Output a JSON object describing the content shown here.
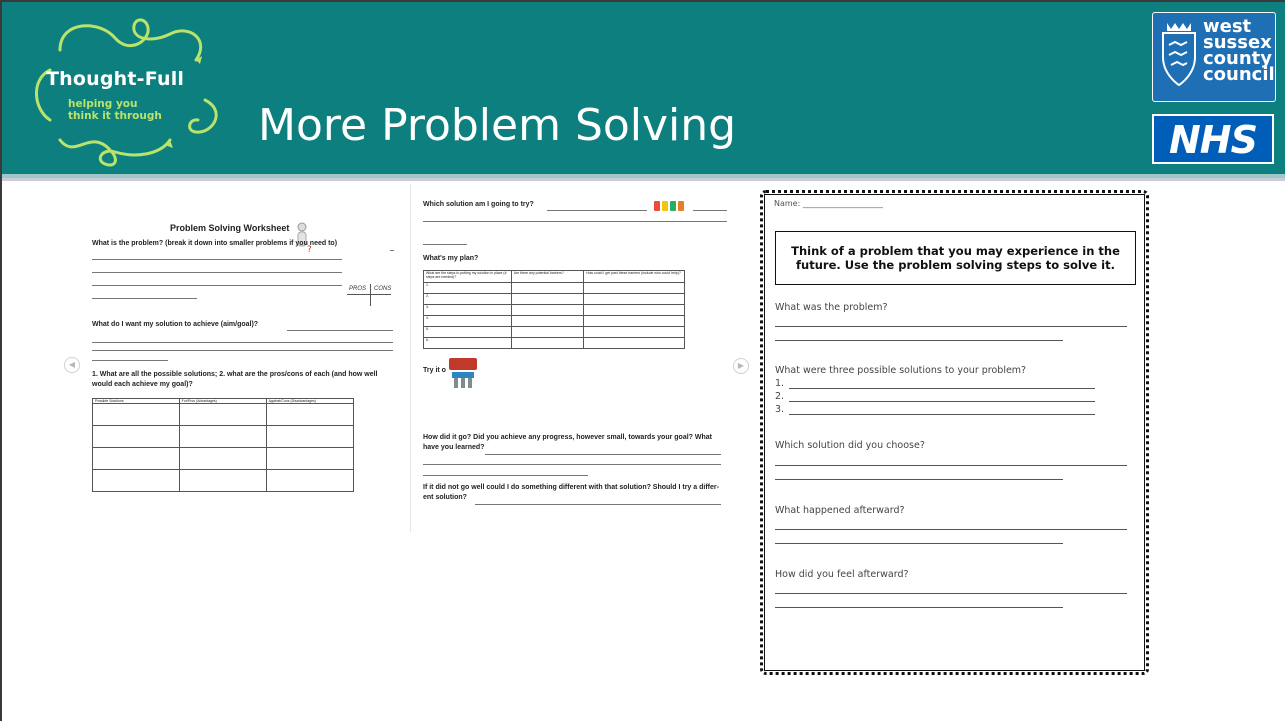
{
  "header": {
    "title": "More Problem Solving",
    "logo": {
      "name": "Thought-Full",
      "tagline_1": "helping you",
      "tagline_2": "think it through"
    },
    "partners": {
      "council_1": "west",
      "council_2": "sussex",
      "council_3": "county",
      "council_4": "council",
      "nhs": "NHS"
    },
    "colors": {
      "header_bg": "#0d7f7f",
      "logo_accent": "#b9e36a",
      "nhs_blue": "#005eb8"
    }
  },
  "worksheet_left": {
    "title": "Problem Solving Worksheet",
    "q1": "What is the problem? (break it down into smaller problems if you need to)",
    "pros": "PROS",
    "cons": "CONS",
    "q2": "What do I want my solution to achieve (aim/goal)?",
    "q3_line1": "1. What are all the possible solutions; 2. what are the pros/cons of each (and how well",
    "q3_line2": "would each achieve my goal)?",
    "table_headers": [
      "Possible Solutions",
      "For/Pros (Advantages)",
      "Against/Cons (Disadvantages)"
    ]
  },
  "worksheet_mid": {
    "q1": "Which solution am I going to try?",
    "q2": "What's my plan?",
    "plan_headers": [
      "What are the steps to putting my solution in place (# steps are needed)?",
      "Are there any potential barriers?",
      "How could I get past these barriers (include who could help)?"
    ],
    "plan_rows": [
      "1.",
      "2.",
      "3.",
      "4.",
      "5.",
      "6."
    ],
    "try_it": "Try it o",
    "q3_line1": "How did it go? Did you achieve any progress, however small, towards your goal?  What",
    "q3_line2": "have you learned?",
    "q4_line1": "If it did not go well could I do something different with that solution?  Should I try a differ-",
    "q4_line2": "ent solution?"
  },
  "worksheet_right": {
    "name_label": "Name: ____________________",
    "instruction_1": "Think of a problem that you may experience in the",
    "instruction_2": "future. Use the problem solving steps to solve it.",
    "q1": "What was the problem?",
    "q2": "What were three possible solutions to your problem?",
    "numbers": [
      "1.",
      "2.",
      "3."
    ],
    "q3": "Which solution did you choose?",
    "q4": "What happened afterward?",
    "q5": "How did you feel afterward?"
  }
}
